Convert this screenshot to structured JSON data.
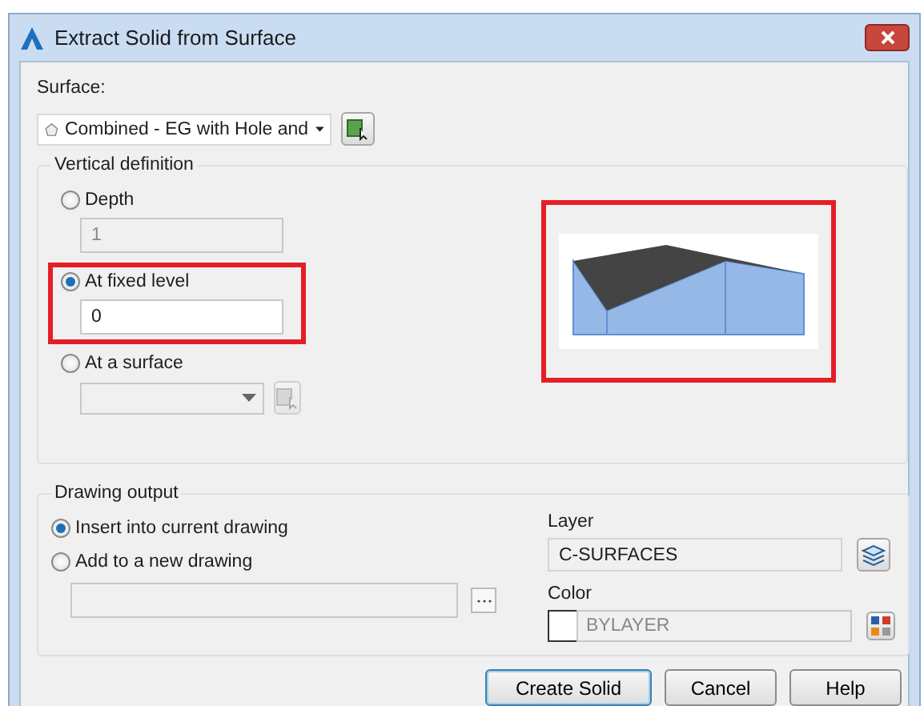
{
  "window": {
    "title": "Extract Solid from Surface"
  },
  "surface": {
    "label": "Surface:",
    "value": "Combined - EG with Hole and"
  },
  "vertical_definition": {
    "title": "Vertical definition",
    "options": [
      {
        "kind": "field",
        "label": "Depth",
        "selected": false,
        "value": "1",
        "disabled": true,
        "highlighted": false
      },
      {
        "kind": "field",
        "label": "At fixed level",
        "selected": true,
        "value": "0",
        "disabled": false,
        "highlighted": true
      },
      {
        "kind": "combo",
        "label": "At a surface",
        "selected": false,
        "disabled": true,
        "highlighted": false
      }
    ],
    "preview": {
      "highlighted": true
    }
  },
  "drawing_output": {
    "title": "Drawing output",
    "options": [
      {
        "label": "Insert into current drawing",
        "selected": true
      },
      {
        "label": "Add to a new drawing",
        "selected": false
      }
    ],
    "layer": {
      "label": "Layer",
      "value": "C-SURFACES"
    },
    "color": {
      "label": "Color",
      "value": "BYLAYER",
      "color": "#ffffff"
    }
  },
  "buttons": [
    {
      "label": "Create Solid",
      "default": true
    },
    {
      "label": "Cancel",
      "default": false
    },
    {
      "label": "Help",
      "default": false
    }
  ]
}
